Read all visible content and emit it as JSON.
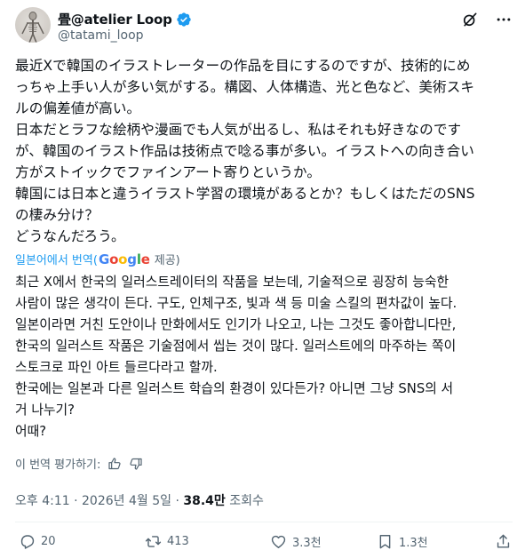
{
  "author": {
    "display_name": "畳@atelier Loop",
    "handle": "@tatami_loop"
  },
  "icons": {
    "verified": "verified-badge-icon",
    "grok": "grok-icon",
    "more": "more-icon",
    "reply": "reply-icon",
    "repost": "repost-icon",
    "like": "like-icon",
    "bookmark": "bookmark-icon",
    "share": "share-icon"
  },
  "colors": {
    "verified": "#1d9bf0",
    "link": "#1d9bf0",
    "secondary_text": "#536471"
  },
  "tweet": {
    "lines": [
      "最近Xで韓国のイラストレーターの作品を目にするのですが、技術的にめ",
      "っちゃ上手い人が多い気がする。構図、人体構造、光と色など、美術スキ",
      "ルの偏差値が高い。",
      "日本だとラフな絵柄や漫画でも人気が出るし、私はそれも好きなのです",
      "が、韓国のイラスト作品は技術点で唸る事が多い。イラストへの向き合い",
      "方がストイックでファインアート寄りというか。",
      "韓国には日本と違うイラスト学習の環境があるとか？もしくはただのSNS",
      "の棲み分け？",
      "どうなんだろう。"
    ]
  },
  "translation": {
    "label": "일본어에서 번역(",
    "google": [
      "G",
      "o",
      "o",
      "g",
      "l",
      "e"
    ],
    "provided": "제공)",
    "lines": [
      "최근 X에서 한국의 일러스트레이터의 작품을 보는데, 기술적으로 굉장히 능숙한",
      "사람이 많은 생각이 든다. 구도, 인체구조, 빛과 색 등 미술 스킬의 편차값이 높다.",
      "일본이라면 거친 도안이나 만화에서도 인기가 나오고, 나는 그것도 좋아합니다만,",
      "한국의 일러스트 작품은 기술점에서 씹는 것이 많다. 일러스트에의 마주하는 쪽이",
      "스토크로 파인 아트 들르다라고 할까.",
      "한국에는 일본과 다른 일러스트 학습의 환경이 있다든가? 아니면 그냥 SNS의 서",
      "거 나누기?",
      "어때?"
    ],
    "rate_label": "이 번역 평가하기:"
  },
  "meta": {
    "time": "오후 4:11",
    "separator1": " · ",
    "date": "2026년 4월 5일",
    "separator2": " · ",
    "views": "38.4만",
    "views_label": " 조회수"
  },
  "actions": {
    "replies": "20",
    "reposts": "413",
    "likes": "3.3천",
    "bookmarks": "1.3천"
  }
}
